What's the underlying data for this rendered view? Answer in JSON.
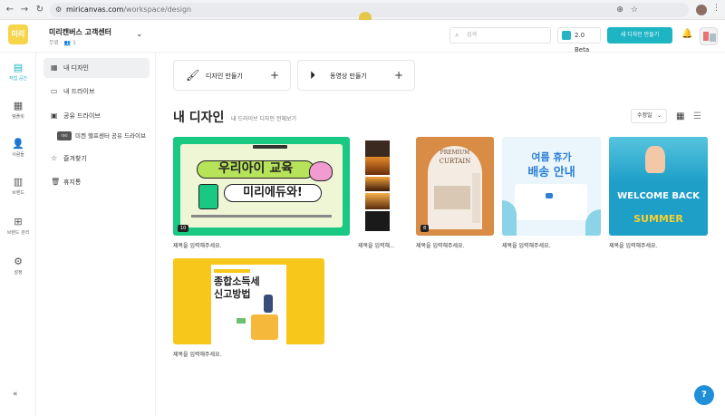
{
  "browser": {
    "host": "miricanvas.com",
    "path": "/workspace/design"
  },
  "workspace": {
    "logo_text": "미리",
    "name": "미리캔버스 고객센터",
    "plan": "무료 · ",
    "members": "1"
  },
  "header": {
    "search_placeholder": "검색",
    "beta_label": "2.0 Beta",
    "new_design_button": "새 디자인 만들기"
  },
  "rail": [
    {
      "icon": "workspace-icon",
      "label": "작업 공간"
    },
    {
      "icon": "template-icon",
      "label": "템플릿"
    },
    {
      "icon": "people-icon",
      "label": "사람들"
    },
    {
      "icon": "brand-icon",
      "label": "브랜드"
    },
    {
      "icon": "brand-manage-icon",
      "label": "브랜드 관리"
    },
    {
      "icon": "settings-icon",
      "label": "설정"
    }
  ],
  "sidebar": {
    "items": [
      {
        "label": "내 디자인"
      },
      {
        "label": "내 드라이브"
      },
      {
        "label": "공유 드라이브"
      },
      {
        "label": "즐겨찾기"
      },
      {
        "label": "휴지통"
      }
    ],
    "shared_drive": {
      "tag": "미리",
      "label": "미켄 헬프센터 공유 드라이브"
    }
  },
  "main": {
    "create_design": "디자인 만들기",
    "create_video": "동영상 만들기",
    "title": "내 디자인",
    "subtitle": "내 드라이브 디자인 전체보기",
    "sort_label": "수정일"
  },
  "designs": [
    {
      "caption": "제목을 입력해주세요.",
      "badge": "10",
      "heading1": "우리아이 교육",
      "heading2": "미리에듀와!"
    },
    {
      "caption": "제목을 입력해...",
      "badge": "",
      "heading1": "",
      "heading2": ""
    },
    {
      "caption": "제목을 입력해주세요.",
      "badge": "8",
      "heading1": "PREMIUM",
      "heading2": "CURTAIN"
    },
    {
      "caption": "제목을 입력해주세요.",
      "badge": "",
      "heading1": "여름 휴가",
      "heading2": "배송 안내"
    },
    {
      "caption": "제목을 입력해주세요.",
      "badge": "",
      "heading1": "WELCOME BACK",
      "heading2": "SUMMER"
    },
    {
      "caption": "제목을 입력해주세요.",
      "badge": "",
      "heading1": "종합소득세",
      "heading2": "신고방법"
    }
  ],
  "colors": {
    "accent": "#1db4c4",
    "green_card": "#19c983",
    "yellow_card": "#f8c71c"
  }
}
